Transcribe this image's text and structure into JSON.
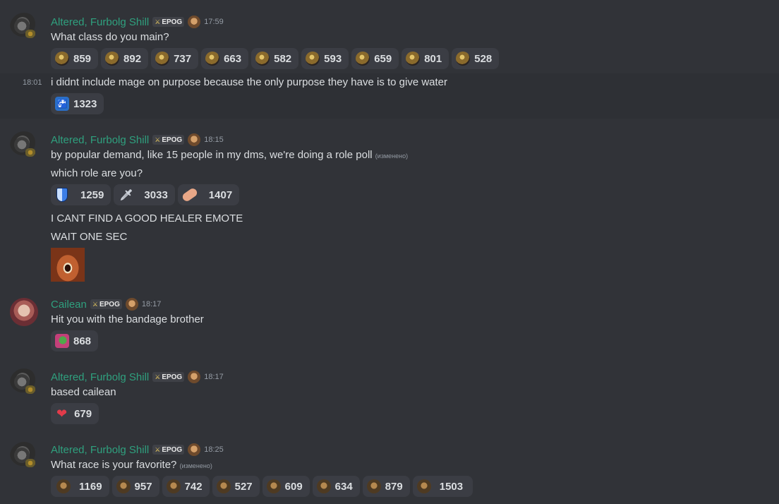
{
  "msg1": {
    "username": "Altered, Furbolg Shill",
    "badge": "EPOG",
    "time": "17:59",
    "text": "What class do you main?",
    "reactions": [
      {
        "icon": "class-warrior-icon",
        "count": "859"
      },
      {
        "icon": "class-paladin-icon",
        "count": "892"
      },
      {
        "icon": "class-priest-icon",
        "count": "737"
      },
      {
        "icon": "class-rogue-icon",
        "count": "663"
      },
      {
        "icon": "class-hunter-icon",
        "count": "582"
      },
      {
        "icon": "class-warlock-icon",
        "count": "593"
      },
      {
        "icon": "class-shaman-icon",
        "count": "659"
      },
      {
        "icon": "class-druid-icon",
        "count": "801"
      },
      {
        "icon": "class-mage-icon",
        "count": "528"
      }
    ]
  },
  "msg2": {
    "side_time": "18:01",
    "text": "i didnt include mage on purpose because the only purpose they have is to give water",
    "reactions": [
      {
        "icon": "water-tap-icon",
        "count": "1323"
      }
    ]
  },
  "msg3": {
    "username": "Altered, Furbolg Shill",
    "badge": "EPOG",
    "time": "18:15",
    "text": "by popular demand, like 15 people in my dms, we're doing a role poll",
    "edited": "(изменено)",
    "text2": "which role are you?",
    "reactions": [
      {
        "icon": "tank-shield-icon",
        "count": "1259"
      },
      {
        "icon": "dps-sword-icon",
        "count": "3033"
      },
      {
        "icon": "healer-bandage-icon",
        "count": "1407"
      }
    ],
    "text3": "I CANT FIND A GOOD HEALER EMOTE",
    "text4": "WAIT ONE SEC"
  },
  "msg4": {
    "username": "Cailean",
    "badge": "EPOG",
    "time": "18:17",
    "text": "Hit you with the bandage brother",
    "reactions": [
      {
        "icon": "pepe-bandage-icon",
        "count": "868"
      }
    ]
  },
  "msg5": {
    "username": "Altered, Furbolg Shill",
    "badge": "EPOG",
    "time": "18:17",
    "text": "based cailean",
    "reactions": [
      {
        "icon": "heart-icon",
        "count": "679"
      }
    ]
  },
  "msg6": {
    "username": "Altered, Furbolg Shill",
    "badge": "EPOG",
    "time": "18:25",
    "text": "What race is your favorite?",
    "edited": "(изменено)",
    "reactions": [
      {
        "icon": "race-undead-icon",
        "count": "1169"
      },
      {
        "icon": "race-human-icon",
        "count": "957"
      },
      {
        "icon": "race-orc-icon",
        "count": "742"
      },
      {
        "icon": "race-dwarf-icon",
        "count": "527"
      },
      {
        "icon": "race-gnome-icon",
        "count": "609"
      },
      {
        "icon": "race-nightelf-icon",
        "count": "634"
      },
      {
        "icon": "race-tauren-icon",
        "count": "879"
      },
      {
        "icon": "race-troll-icon",
        "count": "1503"
      }
    ]
  }
}
